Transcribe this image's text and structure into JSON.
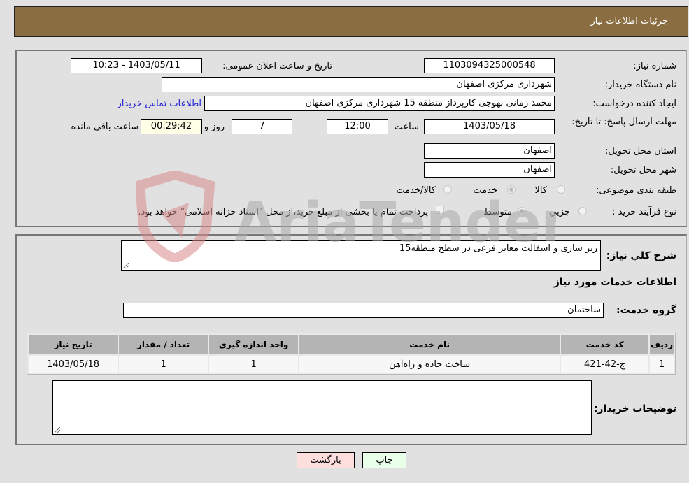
{
  "header": {
    "title": "جزئیات اطلاعات نیاز"
  },
  "details": {
    "need_number": {
      "label": "شماره نیاز:",
      "value": "1103094325000548"
    },
    "announce_datetime": {
      "label": "تاریخ و ساعت اعلان عمومی:",
      "value": "1403/05/11 - 10:23"
    },
    "buyer_org": {
      "label": "نام دستگاه خریدار:",
      "value": "شهرداری مرکزی اصفهان"
    },
    "requester": {
      "label": "ایجاد کننده درخواست:",
      "value": "محمد زمانی نهوجی کارپرداز منطقه 15 شهرداری مرکزی اصفهان"
    },
    "buyer_contact_link": "اطلاعات تماس خریدار",
    "deadline": {
      "label": "مهلت ارسال پاسخ: تا تاریخ:",
      "date": "1403/05/18",
      "time_label": "ساعت",
      "time": "12:00",
      "days": "7",
      "days_label": "روز و",
      "remaining": "00:29:42",
      "remaining_label": "ساعت باقي مانده"
    },
    "province": {
      "label": "استان محل تحویل:",
      "value": "اصفهان"
    },
    "city": {
      "label": "شهر محل تحویل:",
      "value": "اصفهان"
    },
    "category": {
      "label": "طبقه بندی موضوعی:",
      "options": [
        {
          "label": "کالا",
          "checked": false
        },
        {
          "label": "خدمت",
          "checked": true
        },
        {
          "label": "کالا/خدمت",
          "checked": false
        }
      ]
    },
    "purchase_type": {
      "label": "نوع فرآیند خرید :",
      "options": [
        {
          "label": "جزيي",
          "checked": false
        },
        {
          "label": "متوسط",
          "checked": true
        }
      ],
      "treasury_note": "پرداخت تمام یا بخشی از مبلغ خرید،از محل \"اسناد خزانه اسلامی\" خواهد بود."
    }
  },
  "services": {
    "description_label": "شرح کلي نياز:",
    "description": "زیر سازی و آسفالت معابر فرعی در سطح منطقه15",
    "section_title": "اطلاعات خدمات مورد نیاز",
    "group_label": "گروه خدمت:",
    "group_value": "ساختمان",
    "table": {
      "headers": [
        "ردیف",
        "کد خدمت",
        "نام خدمت",
        "واحد اندازه گیری",
        "تعداد / مقدار",
        "تاریخ نیاز"
      ],
      "rows": [
        [
          "1",
          "ج-42-421",
          "ساخت جاده و راه‌آهن",
          "1",
          "1",
          "1403/05/18"
        ]
      ]
    },
    "buyer_notes_label": "توضیحات خریدار:",
    "buyer_notes": ""
  },
  "buttons": {
    "print": "چاپ",
    "back": "بازگشت"
  },
  "watermark": {
    "text": "AriaTender.neT"
  }
}
